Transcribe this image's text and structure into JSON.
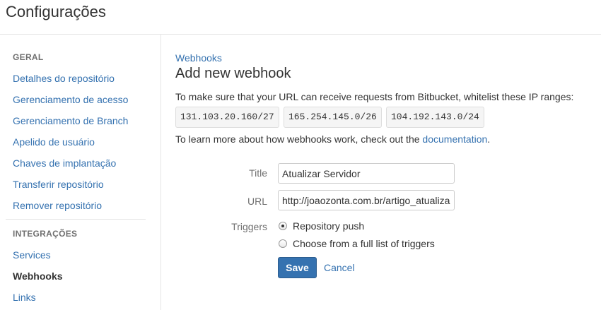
{
  "page": {
    "title": "Configurações"
  },
  "sidebar": {
    "general_heading": "GERAL",
    "general_items": [
      {
        "label": "Detalhes do repositório"
      },
      {
        "label": "Gerenciamento de acesso"
      },
      {
        "label": "Gerenciamento de Branch"
      },
      {
        "label": "Apelido de usuário"
      },
      {
        "label": "Chaves de implantação"
      },
      {
        "label": "Transferir repositório"
      },
      {
        "label": "Remover repositório"
      }
    ],
    "integrations_heading": "INTEGRAÇÕES",
    "integration_items": [
      {
        "label": "Services",
        "active": false
      },
      {
        "label": "Webhooks",
        "active": true
      },
      {
        "label": "Links",
        "active": false
      }
    ]
  },
  "main": {
    "breadcrumb": "Webhooks",
    "heading": "Add new webhook",
    "whitelist_text": "To make sure that your URL can receive requests from Bitbucket, whitelist these IP ranges:",
    "ip_ranges": [
      "131.103.20.160/27",
      "165.254.145.0/26",
      "104.192.143.0/24"
    ],
    "learn_prefix": "To learn more about how webhooks work, check out the ",
    "learn_link": "documentation",
    "learn_suffix": "."
  },
  "form": {
    "title_label": "Title",
    "title_value": "Atualizar Servidor",
    "url_label": "URL",
    "url_value": "http://joaozonta.com.br/artigo_atualizar",
    "triggers_label": "Triggers",
    "trigger_options": [
      {
        "label": "Repository push",
        "checked": true
      },
      {
        "label": "Choose from a full list of triggers",
        "checked": false
      }
    ],
    "save_label": "Save",
    "cancel_label": "Cancel"
  },
  "colors": {
    "link": "#3572b0",
    "primary_button": "#3572b0",
    "text": "#333333",
    "muted": "#707070"
  }
}
